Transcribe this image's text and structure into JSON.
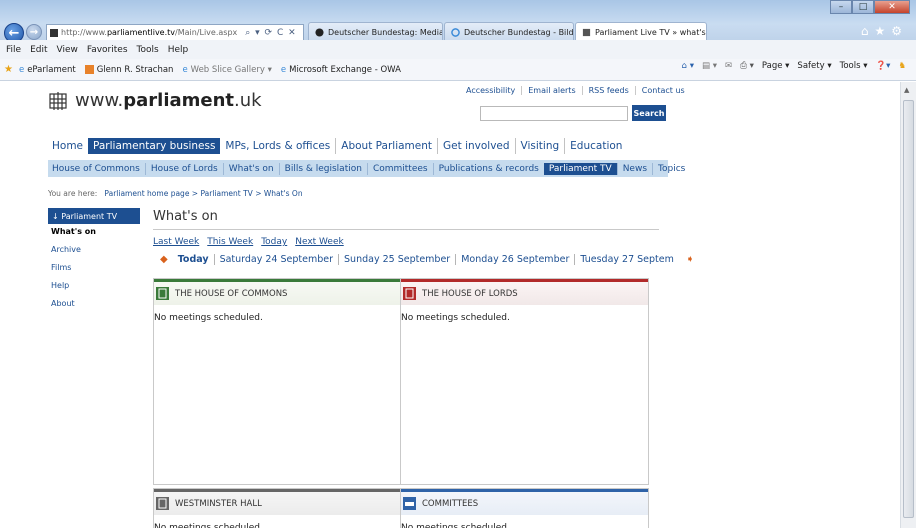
{
  "browser": {
    "address_prefix": "http://www.",
    "address_domain": "parliamentlive.tv",
    "address_path": "/Main/Live.aspx",
    "address_controls": "⌕ ▾ ⟳ C ✕",
    "tabs": [
      {
        "label": "Deutscher Bundestag: Mediath..."
      },
      {
        "label": "Deutscher Bundestag - Bilderdi..."
      },
      {
        "label": "Parliament Live TV » what's ..."
      }
    ],
    "window_controls": {
      "minimize": "–",
      "maximize": "□",
      "close": "✕"
    },
    "menu": [
      "File",
      "Edit",
      "View",
      "Favorites",
      "Tools",
      "Help"
    ],
    "favorites": [
      {
        "label": "eParlament",
        "grey": false
      },
      {
        "label": "Glenn R. Strachan",
        "grey": false
      },
      {
        "label": "Web Slice Gallery ▾",
        "grey": true
      },
      {
        "label": "Microsoft Exchange - OWA",
        "grey": false
      }
    ],
    "command_bar": [
      "Page ▾",
      "Safety ▾",
      "Tools ▾"
    ]
  },
  "site": {
    "logo_prefix": "www.",
    "logo_brand": "parliament",
    "logo_suffix": ".uk",
    "utility_links": [
      "Accessibility",
      "Email alerts",
      "RSS feeds",
      "Contact us"
    ],
    "search_button": "Search",
    "main_nav": [
      "Home",
      "Parliamentary business",
      "MPs, Lords & offices",
      "About Parliament",
      "Get involved",
      "Visiting",
      "Education"
    ],
    "main_nav_active": "Parliamentary business",
    "sub_nav": [
      "House of Commons",
      "House of Lords",
      "What's on",
      "Bills & legislation",
      "Committees",
      "Publications & records",
      "Parliament TV",
      "News",
      "Topics"
    ],
    "sub_nav_active": "Parliament TV",
    "breadcrumb": {
      "prefix": "You are here:",
      "path": "Parliament home page > Parliament TV > What's On"
    },
    "left_nav": {
      "heading": "↓ Parliament TV",
      "items": [
        "What's on",
        "Archive",
        "Films",
        "Help",
        "About"
      ],
      "current": "What's on"
    },
    "page_title": "What's on",
    "week_links": [
      "Last Week",
      "This Week",
      "Today",
      "Next Week"
    ],
    "days": [
      "Today",
      "Saturday 24 September",
      "Sunday 25 September",
      "Monday 26 September",
      "Tuesday 27 Septem"
    ],
    "panels": [
      {
        "title": "THE HOUSE OF COMMONS",
        "body": "No meetings scheduled."
      },
      {
        "title": "THE HOUSE OF LORDS",
        "body": "No meetings scheduled."
      },
      {
        "title": "WESTMINSTER HALL",
        "body": "No meetings scheduled."
      },
      {
        "title": "COMMITTEES",
        "body": "No meetings scheduled."
      }
    ]
  },
  "colors": {
    "brand_blue": "#1d4f91",
    "commons_green": "#3a7a3a",
    "lords_red": "#b22a2a",
    "subnav_bg": "#c6dbee",
    "arrow_orange": "#d9621d"
  }
}
